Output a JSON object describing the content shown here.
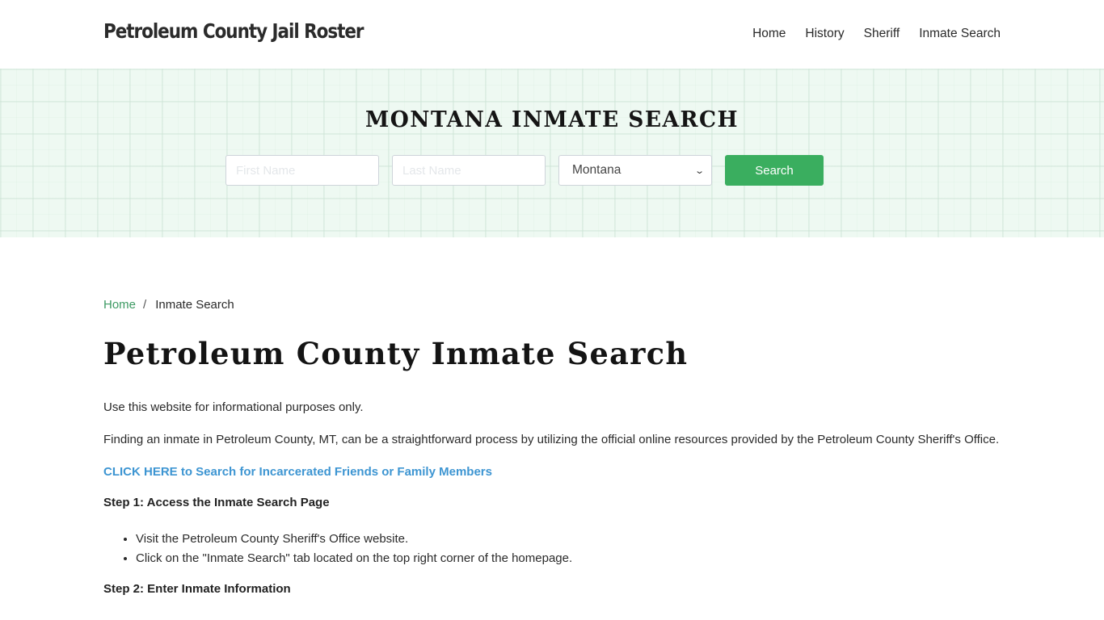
{
  "nav": {
    "brand": "Petroleum County Jail Roster",
    "links": [
      "Home",
      "History",
      "Sheriff",
      "Inmate Search"
    ]
  },
  "hero": {
    "title": "MONTANA INMATE SEARCH",
    "first_name_placeholder": "First Name",
    "last_name_placeholder": "Last Name",
    "state_selected": "Montana",
    "search_label": "Search"
  },
  "breadcrumb": {
    "home": "Home",
    "separator": "/",
    "current": "Inmate Search"
  },
  "main": {
    "title": "Petroleum County Inmate Search",
    "intro": "Use this website for informational purposes only.",
    "paragraph": "Finding an inmate in Petroleum County, MT, can be a straightforward process by utilizing the official online resources provided by the Petroleum County Sheriff's Office.",
    "cta": "CLICK HERE to Search for Incarcerated Friends or Family Members",
    "step1": {
      "heading": "Step 1: Access the Inmate Search Page",
      "items": [
        "Visit the Petroleum County Sheriff's Office website.",
        "Click on the \"Inmate Search\" tab located on the top right corner of the homepage."
      ]
    },
    "step2": {
      "heading": "Step 2: Enter Inmate Information"
    }
  },
  "colors": {
    "accent_green": "#3aae5f",
    "link_blue": "#3d95d2",
    "breadcrumb_green": "#3d9a63",
    "hero_bg": "#eef9f2"
  }
}
